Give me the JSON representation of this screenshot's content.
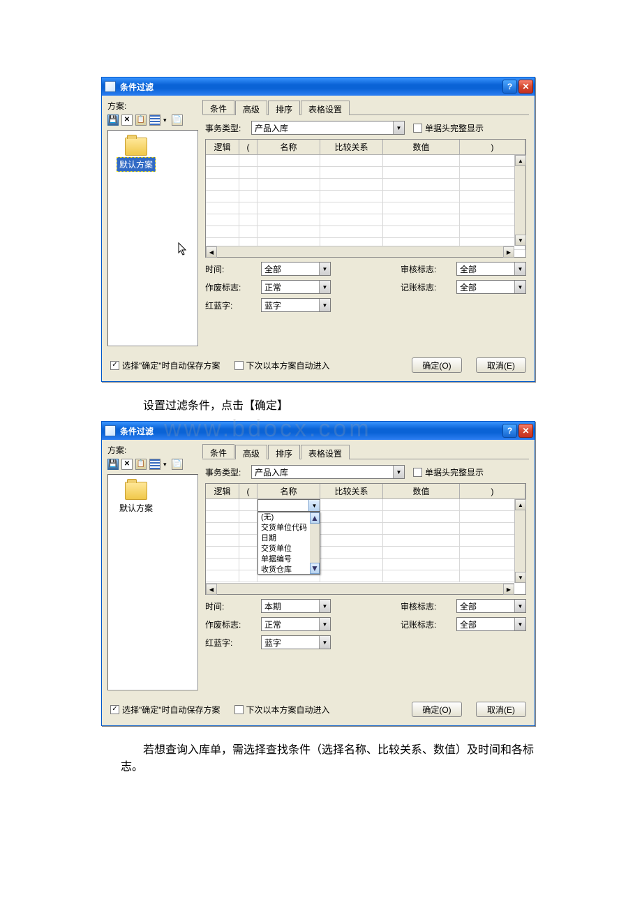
{
  "dialog1": {
    "title": "条件过滤",
    "scheme_label": "方案:",
    "toolbar": {
      "save": "save-icon",
      "delete": "delete-icon",
      "paste": "paste-icon",
      "grid": "grid-icon",
      "dropdown": "▾",
      "props": "properties-icon"
    },
    "scheme_item": "默认方案",
    "tabs": [
      "条件",
      "高级",
      "排序",
      "表格设置"
    ],
    "tx_type_label": "事务类型:",
    "tx_type_value": "产品入库",
    "full_header_chk": "单据头完整显示",
    "grid_cols": {
      "logic": "逻辑",
      "lp": "(",
      "name": "名称",
      "compare": "比较关系",
      "value": "数值",
      "rp": ")"
    },
    "filters": {
      "time_label": "时间:",
      "time_value": "全部",
      "invalid_label": "作废标志:",
      "invalid_value": "正常",
      "redblue_label": "红蓝字:",
      "redblue_value": "蓝字",
      "audit_label": "审核标志:",
      "audit_value": "全部",
      "post_label": "记账标志:",
      "post_value": "全部"
    },
    "footer": {
      "autosave": "选择\"确定\"时自动保存方案",
      "auto_enter": "下次以本方案自动进入",
      "ok": "确定(O)",
      "cancel": "取消(E)"
    }
  },
  "instruction1": "设置过滤条件，点击【确定】",
  "dialog2": {
    "title": "条件过滤",
    "scheme_label": "方案:",
    "scheme_item": "默认方案",
    "tabs": [
      "条件",
      "高级",
      "排序",
      "表格设置"
    ],
    "tx_type_label": "事务类型:",
    "tx_type_value": "产品入库",
    "full_header_chk": "单据头完整显示",
    "grid_cols": {
      "logic": "逻辑",
      "lp": "(",
      "name": "名称",
      "compare": "比较关系",
      "value": "数值",
      "rp": ")"
    },
    "dropdown_items": [
      "(无)",
      "交货单位代码",
      "日期",
      "交货单位",
      "单据编号",
      "收货仓库"
    ],
    "filters": {
      "time_label": "时间:",
      "time_value": "本期",
      "invalid_label": "作废标志:",
      "invalid_value": "正常",
      "redblue_label": "红蓝字:",
      "redblue_value": "蓝字",
      "audit_label": "审核标志:",
      "audit_value": "全部",
      "post_label": "记账标志:",
      "post_value": "全部"
    },
    "footer": {
      "autosave": "选择\"确定\"时自动保存方案",
      "auto_enter": "下次以本方案自动进入",
      "ok": "确定(O)",
      "cancel": "取消(E)"
    }
  },
  "instruction2": "若想查询入库单，需选择查找条件（选择名称、比较关系、数值）及时间和各标志。",
  "watermark": "www.bdocx.com"
}
